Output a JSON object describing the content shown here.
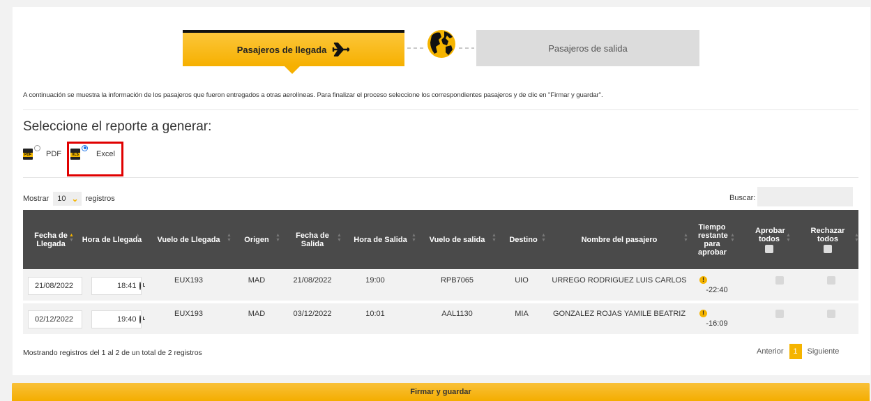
{
  "tabs": {
    "arrival": "Pasajeros de llegada",
    "departure": "Pasajeros de salida"
  },
  "info_text": "A continuación se muestra la información de los pasajeros que fueron entregados a otras aerolíneas. Para finalizar el proceso seleccione los correspondientes pasajeros y de clic en \"Firmar y guardar\".",
  "report": {
    "title": "Seleccione el reporte a generar:",
    "options": [
      {
        "label": "PDF",
        "icon_text": "PDF",
        "checked": false
      },
      {
        "label": "Excel",
        "icon_text": "XLS",
        "checked": true
      }
    ]
  },
  "controls": {
    "show_label": "Mostrar",
    "show_value": "10",
    "records_label": "registros",
    "search_label": "Buscar:"
  },
  "table": {
    "headers": {
      "arrival_date": "Fecha de Llegada",
      "arrival_time": "Hora de Llegada",
      "arrival_flight": "Vuelo de Llegada",
      "origin": "Origen",
      "departure_date": "Fecha de Salida",
      "departure_time": "Hora de Salida",
      "departure_flight": "Vuelo de salida",
      "destination": "Destino",
      "passenger_name": "Nombre del pasajero",
      "time_remaining": "Tiempo restante para aprobar",
      "approve_all": "Aprobar todos",
      "reject_all": "Rechazar todos"
    },
    "rows": [
      {
        "arrival_date": "21/08/2022",
        "arrival_time": "18:41",
        "arrival_flight": "EUX193",
        "origin": "MAD",
        "departure_date": "21/08/2022",
        "departure_time": "19:00",
        "departure_flight": "RPB7065",
        "destination": "UIO",
        "passenger_name": "URREGO RODRIGUEZ LUIS CARLOS",
        "warn": "!",
        "time_remaining": "-22:40"
      },
      {
        "arrival_date": "02/12/2022",
        "arrival_time": "19:40",
        "arrival_flight": "EUX193",
        "origin": "MAD",
        "departure_date": "03/12/2022",
        "departure_time": "10:01",
        "departure_flight": "AAL1130",
        "destination": "MIA",
        "passenger_name": "GONZALEZ ROJAS YAMILE BEATRIZ",
        "warn": "!",
        "time_remaining": "-16:09"
      }
    ]
  },
  "footer": {
    "summary": "Mostrando registros del 1 al 2 de un total de 2 registros",
    "prev": "Anterior",
    "page": "1",
    "next": "Siguiente"
  },
  "save_button": "Firmar y guardar",
  "colors": {
    "accent": "#f5b400",
    "header_bg": "#4a4a4a",
    "highlight": "#e00000"
  }
}
